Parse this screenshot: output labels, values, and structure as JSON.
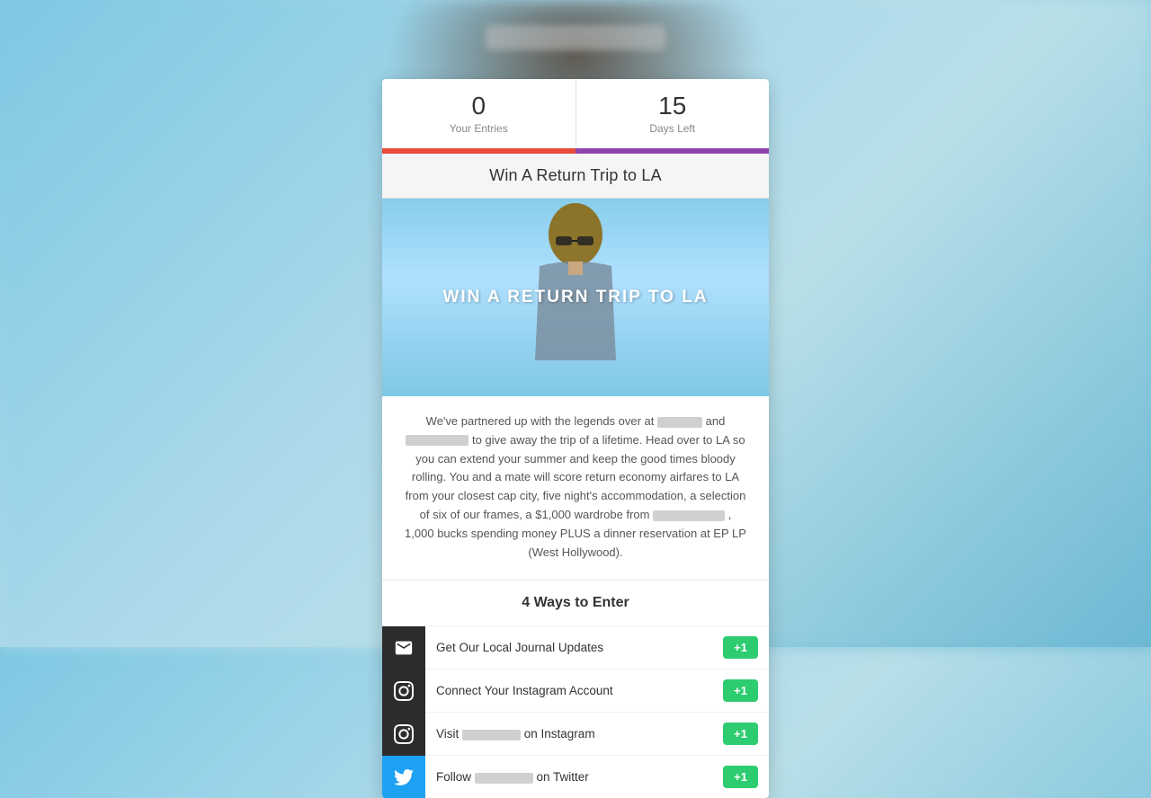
{
  "topBar": {
    "blurred": true
  },
  "stats": {
    "entries": {
      "value": "0",
      "label": "Your Entries"
    },
    "days": {
      "value": "15",
      "label": "Days Left"
    }
  },
  "contest": {
    "title": "Win A Return Trip to LA",
    "heroText": "WIN A RETURN TRIP TO LA",
    "description": "We've partnered up with the legends over at [brand] and [brand] to give away the trip of a lifetime. Head over to LA so you can extend your summer and keep the good times bloody rolling. You and a mate will score return economy airfares to LA from your closest cap city, five night's accommodation, a selection of six of our frames, a $1,000 wardrobe from [brand], 1,000 bucks spending money PLUS a dinner reservation at EP LP (West Hollywood).",
    "waysTitle": "4 Ways to Enter",
    "entries": [
      {
        "id": "email",
        "icon": "email",
        "label": "Get Our Local Journal Updates",
        "badge": "+1"
      },
      {
        "id": "instagram-connect",
        "icon": "instagram",
        "label": "Connect Your Instagram Account",
        "badge": "+1"
      },
      {
        "id": "instagram-visit",
        "icon": "instagram",
        "label": "Visit [brand] on Instagram",
        "badge": "+1"
      },
      {
        "id": "twitter",
        "icon": "twitter",
        "label": "Follow [brand] on Twitter",
        "badge": "+1"
      }
    ]
  }
}
